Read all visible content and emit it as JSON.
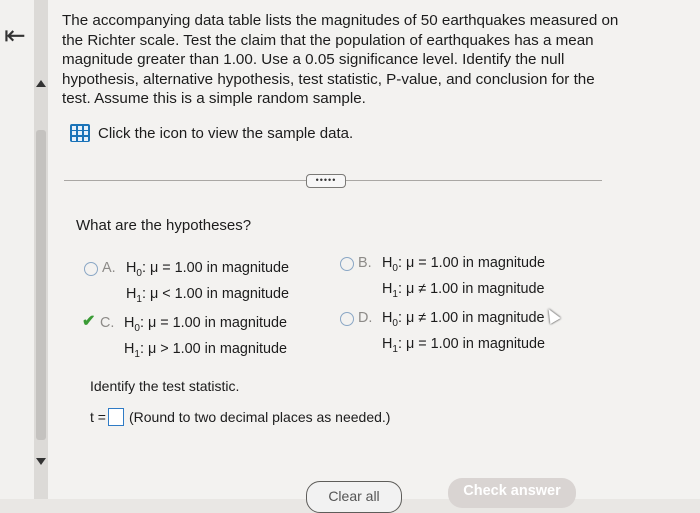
{
  "nav": {
    "back_icon": "⇤"
  },
  "question": {
    "text": "The accompanying data table lists the magnitudes of 50 earthquakes measured on the Richter scale. Test the claim that the population of earthquakes has a mean magnitude greater than 1.00. Use a 0.05 significance level. Identify the null hypothesis, alternative hypothesis, test statistic, P-value, and conclusion for the test. Assume this is a simple random sample.",
    "data_link": "Click the icon to view the sample data.",
    "ellipsis": "•••••"
  },
  "hypotheses": {
    "prompt": "What are the hypotheses?",
    "options": [
      {
        "letter": "A.",
        "h0_sym": "H",
        "h0_sub": "0",
        "h0_rest": ": μ = 1.00 in magnitude",
        "h1_sym": "H",
        "h1_sub": "1",
        "h1_rest": ": μ < 1.00 in magnitude"
      },
      {
        "letter": "B.",
        "h0_sym": "H",
        "h0_sub": "0",
        "h0_rest": ": μ = 1.00 in magnitude",
        "h1_sym": "H",
        "h1_sub": "1",
        "h1_rest": ": μ ≠ 1.00 in magnitude"
      },
      {
        "letter": "C.",
        "h0_sym": "H",
        "h0_sub": "0",
        "h0_rest": ": μ = 1.00 in magnitude",
        "h1_sym": "H",
        "h1_sub": "1",
        "h1_rest": ": μ > 1.00 in magnitude"
      },
      {
        "letter": "D.",
        "h0_sym": "H",
        "h0_sub": "0",
        "h0_rest": ": μ ≠ 1.00 in magnitude",
        "h1_sym": "H",
        "h1_sub": "1",
        "h1_rest": ": μ = 1.00 in magnitude"
      }
    ],
    "selected": "C",
    "selected_mark": "✔"
  },
  "test_statistic": {
    "prompt": "Identify the test statistic.",
    "label": "t =",
    "value": "",
    "hint": "(Round to two decimal places as needed.)"
  },
  "buttons": {
    "clear": "Clear all",
    "check": "Check answer"
  },
  "colors": {
    "accent": "#2f7bc5",
    "correct": "#3a9b35",
    "disabled_button": "#d9d4d2"
  }
}
